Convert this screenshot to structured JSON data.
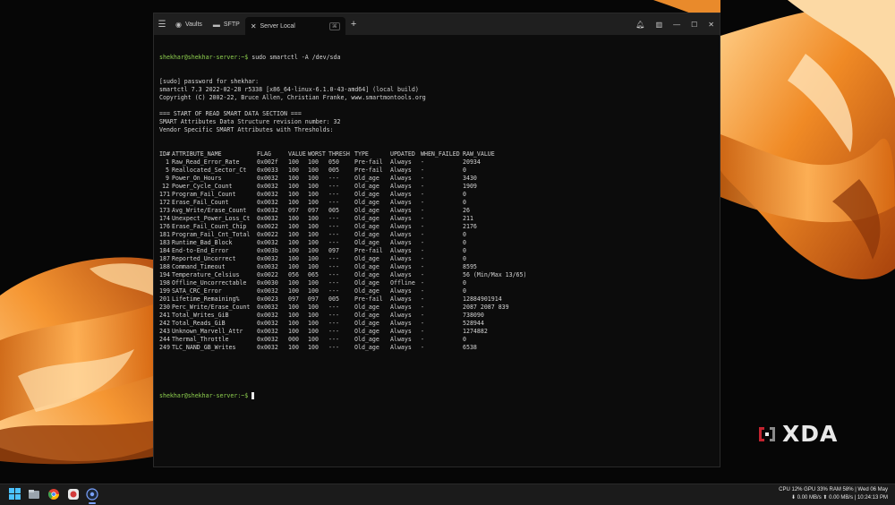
{
  "window": {
    "tabs": [
      {
        "label": "Vaults",
        "icon": "chat-bubble-icon"
      },
      {
        "label": "SFTP",
        "icon": "folder-icon"
      },
      {
        "label": "Server Local",
        "icon": "close-icon",
        "shortcut": "⌘"
      }
    ]
  },
  "terminal": {
    "prompt": "shekhar@shekhar-server:~$",
    "command": " sudo smartctl -A /dev/sda",
    "header_lines": [
      "[sudo] password for shekhar:",
      "smartctl 7.3 2022-02-28 r5338 [x86_64-linux-6.1.0-43-amd64] (local build)",
      "Copyright (C) 2002-22, Bruce Allen, Christian Franke, www.smartmontools.org",
      "",
      "=== START OF READ SMART DATA SECTION ===",
      "SMART Attributes Data Structure revision number: 32",
      "Vendor Specific SMART Attributes with Thresholds:"
    ],
    "columns": [
      "ID#",
      "ATTRIBUTE_NAME",
      "FLAG",
      "VALUE",
      "WORST",
      "THRESH",
      "TYPE",
      "UPDATED",
      "WHEN_FAILED",
      "RAW_VALUE"
    ],
    "rows": [
      [
        "1",
        "Raw_Read_Error_Rate",
        "0x002f",
        "100",
        "100",
        "050",
        "Pre-fail",
        "Always",
        "-",
        "20934"
      ],
      [
        "5",
        "Reallocated_Sector_Ct",
        "0x0033",
        "100",
        "100",
        "005",
        "Pre-fail",
        "Always",
        "-",
        "0"
      ],
      [
        "9",
        "Power_On_Hours",
        "0x0032",
        "100",
        "100",
        "---",
        "Old_age",
        "Always",
        "-",
        "3430"
      ],
      [
        "12",
        "Power_Cycle_Count",
        "0x0032",
        "100",
        "100",
        "---",
        "Old_age",
        "Always",
        "-",
        "1909"
      ],
      [
        "171",
        "Program_Fail_Count",
        "0x0032",
        "100",
        "100",
        "---",
        "Old_age",
        "Always",
        "-",
        "0"
      ],
      [
        "172",
        "Erase_Fail_Count",
        "0x0032",
        "100",
        "100",
        "---",
        "Old_age",
        "Always",
        "-",
        "0"
      ],
      [
        "173",
        "Avg_Write/Erase_Count",
        "0x0032",
        "097",
        "097",
        "005",
        "Old_age",
        "Always",
        "-",
        "26"
      ],
      [
        "174",
        "Unexpect_Power_Loss_Ct",
        "0x0032",
        "100",
        "100",
        "---",
        "Old_age",
        "Always",
        "-",
        "211"
      ],
      [
        "176",
        "Erase_Fail_Count_Chip",
        "0x0022",
        "100",
        "100",
        "---",
        "Old_age",
        "Always",
        "-",
        "2176"
      ],
      [
        "181",
        "Program_Fail_Cnt_Total",
        "0x0022",
        "100",
        "100",
        "---",
        "Old_age",
        "Always",
        "-",
        "0"
      ],
      [
        "183",
        "Runtime_Bad_Block",
        "0x0032",
        "100",
        "100",
        "---",
        "Old_age",
        "Always",
        "-",
        "0"
      ],
      [
        "184",
        "End-to-End_Error",
        "0x003b",
        "100",
        "100",
        "097",
        "Pre-fail",
        "Always",
        "-",
        "0"
      ],
      [
        "187",
        "Reported_Uncorrect",
        "0x0032",
        "100",
        "100",
        "---",
        "Old_age",
        "Always",
        "-",
        "0"
      ],
      [
        "188",
        "Command_Timeout",
        "0x0032",
        "100",
        "100",
        "---",
        "Old_age",
        "Always",
        "-",
        "8595"
      ],
      [
        "194",
        "Temperature_Celsius",
        "0x0022",
        "056",
        "065",
        "---",
        "Old_age",
        "Always",
        "-",
        "56 (Min/Max 13/65)"
      ],
      [
        "198",
        "Offline_Uncorrectable",
        "0x0030",
        "100",
        "100",
        "---",
        "Old_age",
        "Offline",
        "-",
        "0"
      ],
      [
        "199",
        "SATA_CRC_Error",
        "0x0032",
        "100",
        "100",
        "---",
        "Old_age",
        "Always",
        "-",
        "0"
      ],
      [
        "201",
        "Lifetime_Remaining%",
        "0x0023",
        "097",
        "097",
        "005",
        "Pre-fail",
        "Always",
        "-",
        "12884901914"
      ],
      [
        "230",
        "Perc_Write/Erase_Count",
        "0x0032",
        "100",
        "100",
        "---",
        "Old_age",
        "Always",
        "-",
        "2087 2087 839"
      ],
      [
        "241",
        "Total_Writes_GiB",
        "0x0032",
        "100",
        "100",
        "---",
        "Old_age",
        "Always",
        "-",
        "738090"
      ],
      [
        "242",
        "Total_Reads_GiB",
        "0x0032",
        "100",
        "100",
        "---",
        "Old_age",
        "Always",
        "-",
        "528944"
      ],
      [
        "243",
        "Unknown_Marvell_Attr",
        "0x0032",
        "100",
        "100",
        "---",
        "Old_age",
        "Always",
        "-",
        "1274882"
      ],
      [
        "244",
        "Thermal_Throttle",
        "0x0032",
        "000",
        "100",
        "---",
        "Old_age",
        "Always",
        "-",
        "0"
      ],
      [
        "249",
        "TLC_NAND_GB_Writes",
        "0x0032",
        "100",
        "100",
        "---",
        "Old_age",
        "Always",
        "-",
        "6538"
      ]
    ],
    "final_prompt": "shekhar@shekhar-server:~$"
  },
  "watermark": {
    "text": "XDA"
  },
  "system_tray": {
    "line1": "CPU 12% GPU 33% RAM 58% | Wed 06 May",
    "line2": "⬇ 0.00 MB/s ⬆ 0.00 MB/s | 10:24:13 PM"
  },
  "colors": {
    "prompt": "#8fd14f",
    "terminal_bg": "#0c0c0c",
    "silk": "#f0902a"
  }
}
